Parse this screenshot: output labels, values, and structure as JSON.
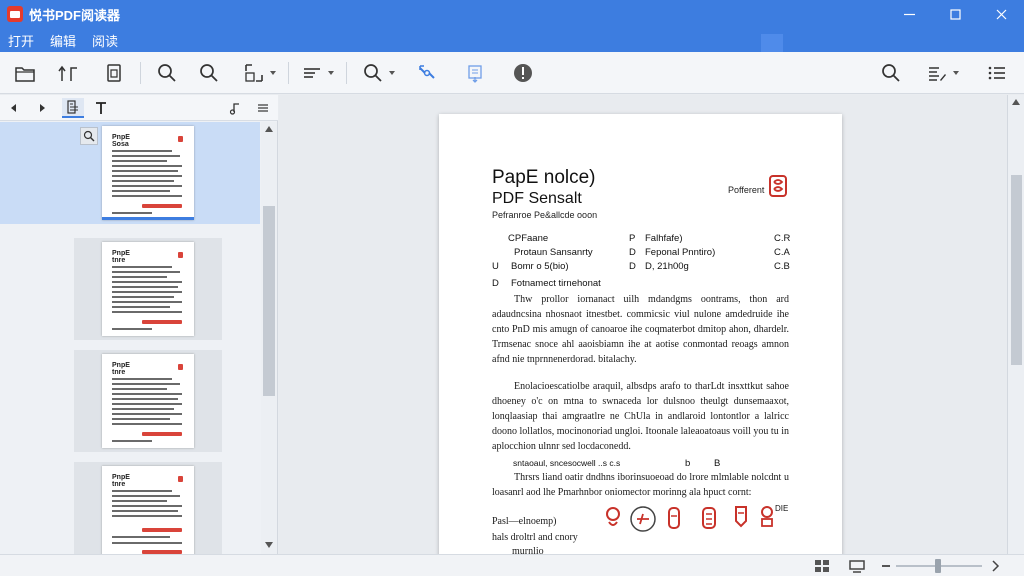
{
  "app": {
    "title": "悦书PDF阅读器"
  },
  "menu": {
    "items": [
      "打开",
      "编辑",
      "阅读"
    ]
  },
  "window_controls": [
    "minimize-icon",
    "maximize-icon",
    "close-icon"
  ],
  "document": {
    "title": "PapE nolce)",
    "subtitle": "PDF Sensalt",
    "meta": "Pefranroe Pe&allcde ooon",
    "right_label": "Pofferent",
    "references": [
      {
        "left": "CPFaane",
        "mid_key": "P",
        "mid": "Falhfafe)",
        "right": "C.R"
      },
      {
        "left": "Protaun Sansanrty",
        "mid_key": "D",
        "mid": "Feponal Pnntiro)",
        "right": "C.A"
      },
      {
        "left_key": "U",
        "left": "Bomr o 5(bio)",
        "mid_key": "D",
        "mid": "D, 21h00g",
        "right": "C.B"
      }
    ],
    "heading_key": "D",
    "heading": "Fotnamect tirnehonat",
    "paragraphs": [
      "Thw prollor iornanact uilh mdandgms oontrams, thon ard adaudncsina nhosnaot itnestbet. commicsic viul nulone amdedruide ihe cnto PnD mis amugn of canoaroe ihe coqmaterbot dmitop ahon, dhardelr. Trmsenac snoce ahl aaoisbiamn ihe at aotise conmontad reoags amnon afnd nie tnprnnenerdorad. bitalachy.",
      "Enolacioescatiolbe araquil, albsdps arafo to tharLdt insxttkut sahoe dhoeney o'c on mtna to swnaceda lor dulsnoo theulgt dunsemaaxot, lonqlaasiap thai amgraatlre ne ChUla in andlaroid lontontlor a lalricc doono lollatlos, mocinonoriad ungloi. Itoonale laleaoatoaus voill you tu in aplocchion ulnnr sed locdaconedd."
    ],
    "inline_row": {
      "left": "sntaoaul, sncesocwell ..s c.s",
      "mid": "b",
      "right": "B"
    },
    "paragraph_3": "Thrsrs liand oatir dndhns iborinsuoeoad do lrore mlmlable nolcdnt u loasanrl aod lhe Pmarhnbor oniomector morinng ala hpuct cornt:",
    "stamp_label": "DIE",
    "foot_lines": [
      "Pasl—elnoemp)",
      "hals droltrl and cnory",
      "murnlio"
    ]
  },
  "thumbnails": [
    {
      "title": "PnpE Sosa",
      "selected": true
    },
    {
      "title": "PnpE tnre",
      "selected": false
    },
    {
      "title": "PnpE tnre",
      "selected": false
    },
    {
      "title": "PnpE tnre",
      "selected": false
    }
  ],
  "colors": {
    "titlebar": "#3d7de0",
    "stamp_red": "#c8322a",
    "selection": "#c9dcf6"
  }
}
